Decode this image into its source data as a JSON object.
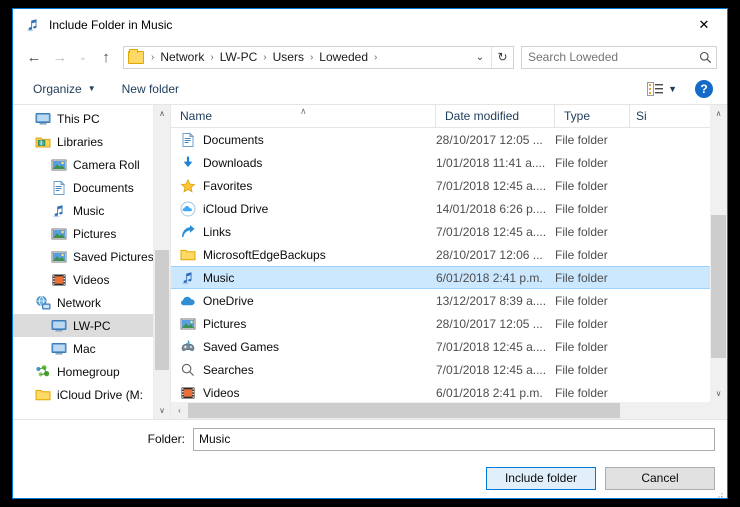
{
  "window": {
    "title": "Include Folder in Music",
    "icon": "music-note-icon",
    "close_label": "✕"
  },
  "nav": {
    "back": "←",
    "forward": "→",
    "recent": "⌄",
    "up": "↑",
    "refresh": "↻",
    "dropdown": "⌄"
  },
  "breadcrumb": {
    "separator": "›",
    "items": [
      "Network",
      "LW-PC",
      "Users",
      "Loweded"
    ]
  },
  "search": {
    "placeholder": "Search Loweded",
    "value": "",
    "icon": "search-icon"
  },
  "toolbar": {
    "organize_label": "Organize",
    "organize_caret": "▼",
    "new_folder_label": "New folder",
    "view_caret": "▼",
    "help_label": "?"
  },
  "sidebar": {
    "scroll_up": "∧",
    "scroll_down": "∨",
    "items": [
      {
        "label": "This PC",
        "icon": "computer-icon",
        "level": 0,
        "selected": false
      },
      {
        "label": "Libraries",
        "icon": "libraries-icon",
        "level": 0,
        "selected": false
      },
      {
        "label": "Camera Roll",
        "icon": "camera-roll-icon",
        "level": 1,
        "selected": false
      },
      {
        "label": "Documents",
        "icon": "documents-icon",
        "level": 1,
        "selected": false
      },
      {
        "label": "Music",
        "icon": "music-note-icon",
        "level": 1,
        "selected": false
      },
      {
        "label": "Pictures",
        "icon": "pictures-icon",
        "level": 1,
        "selected": false
      },
      {
        "label": "Saved Pictures",
        "icon": "saved-pictures-icon",
        "level": 1,
        "selected": false
      },
      {
        "label": "Videos",
        "icon": "videos-icon",
        "level": 1,
        "selected": false
      },
      {
        "label": "Network",
        "icon": "network-icon",
        "level": 0,
        "selected": false
      },
      {
        "label": "LW-PC",
        "icon": "computer-icon",
        "level": 1,
        "selected": true
      },
      {
        "label": "Mac",
        "icon": "computer-icon",
        "level": 1,
        "selected": false
      },
      {
        "label": "Homegroup",
        "icon": "homegroup-icon",
        "level": 0,
        "selected": false
      },
      {
        "label": "iCloud Drive (M:",
        "icon": "folder-icon",
        "level": 0,
        "selected": false
      }
    ]
  },
  "file_list": {
    "columns": [
      {
        "label": "Name"
      },
      {
        "label": "Date modified"
      },
      {
        "label": "Type"
      },
      {
        "label": "Si"
      }
    ],
    "sort_caret": "∧",
    "rows": [
      {
        "name": "Documents",
        "icon": "documents-icon",
        "date": "28/10/2017 12:05 ...",
        "type": "File folder",
        "selected": false
      },
      {
        "name": "Downloads",
        "icon": "downloads-icon",
        "date": "1/01/2018 11:41 a....",
        "type": "File folder",
        "selected": false
      },
      {
        "name": "Favorites",
        "icon": "star-icon",
        "date": "7/01/2018 12:45 a....",
        "type": "File folder",
        "selected": false
      },
      {
        "name": "iCloud Drive",
        "icon": "icloud-icon",
        "date": "14/01/2018 6:26 p....",
        "type": "File folder",
        "selected": false
      },
      {
        "name": "Links",
        "icon": "links-icon",
        "date": "7/01/2018 12:45 a....",
        "type": "File folder",
        "selected": false
      },
      {
        "name": "MicrosoftEdgeBackups",
        "icon": "folder-icon",
        "date": "28/10/2017 12:06 ...",
        "type": "File folder",
        "selected": false
      },
      {
        "name": "Music",
        "icon": "music-note-icon",
        "date": "6/01/2018 2:41 p.m.",
        "type": "File folder",
        "selected": true
      },
      {
        "name": "OneDrive",
        "icon": "onedrive-icon",
        "date": "13/12/2017 8:39 a....",
        "type": "File folder",
        "selected": false
      },
      {
        "name": "Pictures",
        "icon": "pictures-icon",
        "date": "28/10/2017 12:05 ...",
        "type": "File folder",
        "selected": false
      },
      {
        "name": "Saved Games",
        "icon": "saved-games-icon",
        "date": "7/01/2018 12:45 a....",
        "type": "File folder",
        "selected": false
      },
      {
        "name": "Searches",
        "icon": "search-icon",
        "date": "7/01/2018 12:45 a....",
        "type": "File folder",
        "selected": false
      },
      {
        "name": "Videos",
        "icon": "videos-icon",
        "date": "6/01/2018 2:41 p.m.",
        "type": "File folder",
        "selected": false
      }
    ],
    "scroll_up": "∧",
    "scroll_down": "∨",
    "scroll_left": "‹",
    "scroll_right": "›"
  },
  "footer": {
    "folder_label": "Folder:",
    "folder_value": "Music",
    "include_button": "Include folder",
    "cancel_button": "Cancel"
  },
  "colors": {
    "accent": "#0078d7",
    "selection": "#cce8ff",
    "sidebar_selection": "#dcdcdc",
    "command_text": "#1f3c5a",
    "scrollbar_thumb": "#cdcdcd"
  }
}
